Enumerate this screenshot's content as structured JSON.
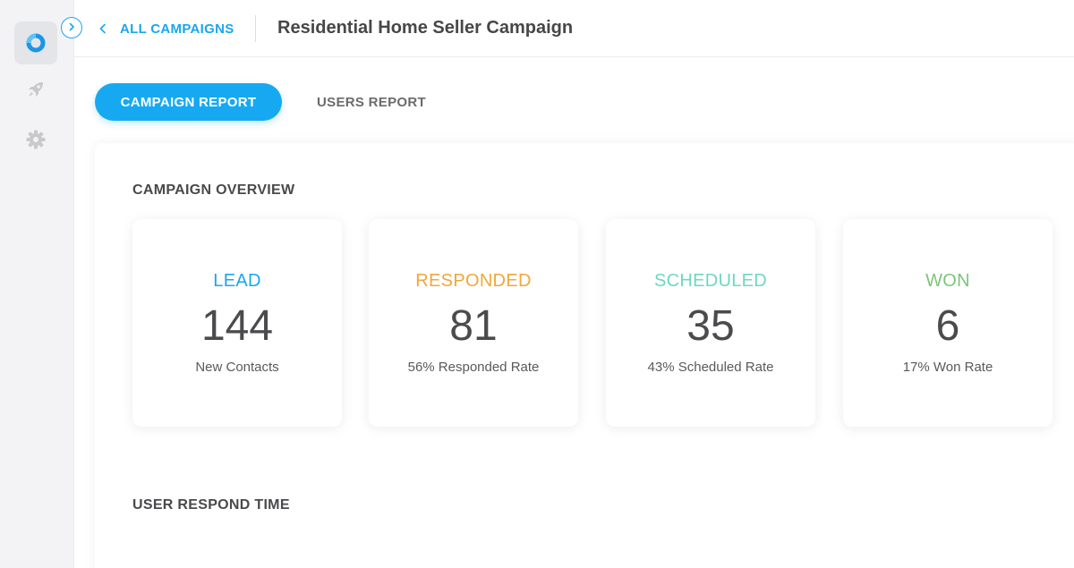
{
  "header": {
    "back_label": "ALL CAMPAIGNS",
    "title": "Residential Home Seller Campaign"
  },
  "sidebar": {
    "items": [
      {
        "icon": "donut-logo-icon",
        "active": true
      },
      {
        "icon": "rocket-icon",
        "active": false
      },
      {
        "icon": "gear-icon",
        "active": false
      }
    ]
  },
  "tabs": [
    {
      "label": "CAMPAIGN REPORT",
      "active": true
    },
    {
      "label": "USERS REPORT",
      "active": false
    }
  ],
  "overview": {
    "title": "CAMPAIGN OVERVIEW",
    "cards": [
      {
        "label": "LEAD",
        "value": "144",
        "sub": "New Contacts",
        "color": "#1aa6ef"
      },
      {
        "label": "RESPONDED",
        "value": "81",
        "sub": "56% Responded Rate",
        "color": "#f1a73a"
      },
      {
        "label": "SCHEDULED",
        "value": "35",
        "sub": "43% Scheduled Rate",
        "color": "#6fd6c4"
      },
      {
        "label": "WON",
        "value": "6",
        "sub": "17% Won Rate",
        "color": "#7bc67a"
      }
    ]
  },
  "respond_time": {
    "title": "USER RESPOND TIME"
  },
  "colors": {
    "accent": "#16a9f2",
    "sidebar_bg": "#f3f3f5",
    "icon_gray": "#c9c9cc"
  }
}
